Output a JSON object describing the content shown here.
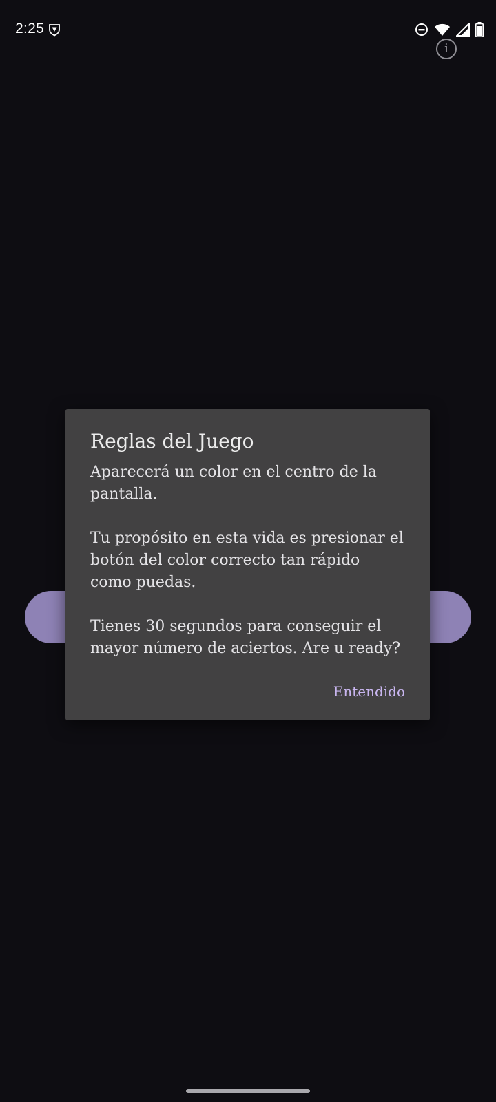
{
  "status_bar": {
    "time": "2:25",
    "icons": [
      "vpn-shield-icon",
      "do-not-disturb-icon",
      "wifi-icon",
      "cell-signal-icon",
      "battery-icon"
    ]
  },
  "info_button": {
    "glyph": "i",
    "icon": "info-icon"
  },
  "dialog": {
    "title": "Reglas del Juego",
    "message": "Aparecerá un color en el centro de la pantalla.\n\n Tu propósito en esta vida es presionar el botón del color correcto tan rápido como puedas.\n\n Tienes 30 segundos para conseguir el mayor número de aciertos. Are u ready?",
    "confirm_label": "Entendido"
  },
  "colors": {
    "background": "#0e0d12",
    "dialog_surface": "#424142",
    "accent": "#c9b6f0",
    "background_button": "#8e82b5"
  }
}
